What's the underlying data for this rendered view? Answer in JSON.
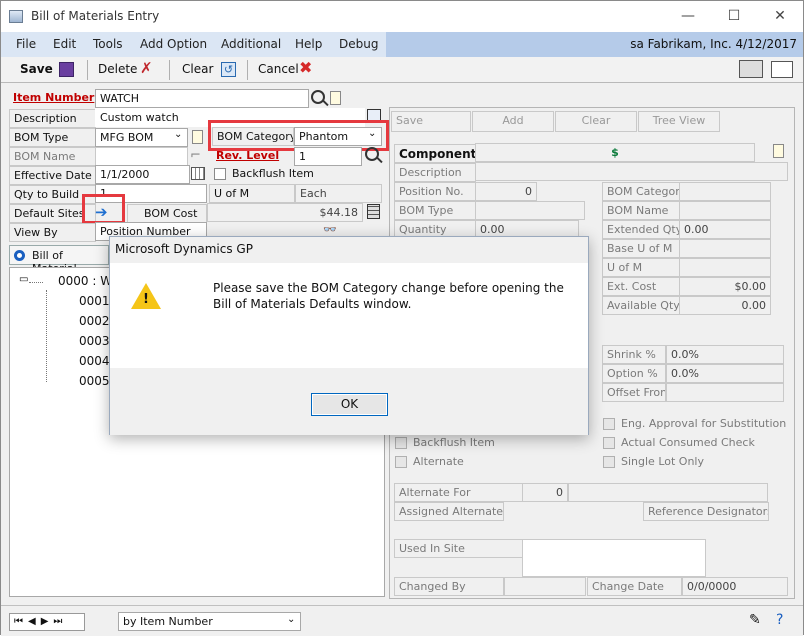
{
  "window": {
    "title": "Bill of Materials Entry",
    "minimize_glyph": "—",
    "maximize_glyph": "☐",
    "close_glyph": "✕"
  },
  "menu": {
    "items": [
      "File",
      "Edit",
      "Tools",
      "Add Option",
      "Additional",
      "Help",
      "Debug"
    ],
    "status": "sa  Fabrikam, Inc.  4/12/2017"
  },
  "toolbar": {
    "save": "Save",
    "delete": "Delete",
    "clear": "Clear",
    "cancel": "Cancel"
  },
  "form": {
    "item_number_label": "Item Number",
    "item_number": "WATCH",
    "description_label": "Description",
    "description": "Custom watch",
    "bom_type_label": "BOM Type",
    "bom_type": "MFG BOM",
    "bom_name_label": "BOM Name",
    "bom_category_label": "BOM Category",
    "bom_category": "Phantom",
    "rev_level_label": "Rev. Level",
    "rev_level": "1",
    "effective_date_label": "Effective Date",
    "effective_date": "1/1/2000",
    "backflush_label": "Backflush Item",
    "qty_to_build_label": "Qty to Build",
    "qty_to_build": "1",
    "uofm_label": "U of M",
    "uofm": "Each",
    "default_sites_label": "Default Sites",
    "bom_cost_label": "BOM Cost",
    "bom_cost": "$44.18",
    "view_by_label": "View By",
    "view_by": "Position Number",
    "bom_tab": "Bill of Material"
  },
  "tree": {
    "root": "0000 : WA",
    "children": [
      "0001 :",
      "0002 :",
      "0003 :",
      "0004 :",
      "0005 :"
    ]
  },
  "right": {
    "buttons": {
      "save": "Save",
      "add": "Add",
      "clear": "Clear",
      "tree_view": "Tree View"
    },
    "component_label": "Component",
    "component_currency": "$",
    "description_label": "Description",
    "position_no_label": "Position No.",
    "position_no": "0",
    "bom_type_label": "BOM Type",
    "quantity_label": "Quantity",
    "quantity": "0.00",
    "bom_category_label": "BOM Category",
    "bom_name_label": "BOM Name",
    "extended_qty_label": "Extended Qty",
    "extended_qty": "0.00",
    "base_uofm_label": "Base U of M",
    "uofm_label": "U of M",
    "ext_cost_label": "Ext. Cost",
    "ext_cost": "$0.00",
    "available_qty_label": "Available Qty.",
    "available_qty": "0.00",
    "shrink_label": "Shrink %",
    "shrink": "0.0%",
    "option_label": "Option %",
    "option": "0.0%",
    "offset_from_label": "Offset From:",
    "eng_approval_label": "Eng. Approval for Substitution",
    "actual_consumed_label": "Actual Consumed Check",
    "single_lot_label": "Single Lot Only",
    "backflush_item_label": "Backflush Item",
    "alternate_label": "Alternate",
    "alternate_for_label": "Alternate For",
    "alternate_for": "0",
    "assigned_alternates_label": "Assigned Alternates",
    "reference_designators_label": "Reference Designators",
    "used_in_site_label": "Used In Site",
    "changed_by_label": "Changed By",
    "change_date_label": "Change Date",
    "change_date": "0/0/0000"
  },
  "dialog": {
    "title": "Microsoft Dynamics GP",
    "message": "Please save the BOM Category change before opening the Bill of Materials Defaults window.",
    "ok": "OK"
  },
  "bottom": {
    "sort": "by Item Number"
  },
  "colors": {
    "highlight": "#e5393f",
    "required_label": "#c00000",
    "menubar": "#dbe6f4",
    "menubar_right": "#b5cbe9"
  }
}
